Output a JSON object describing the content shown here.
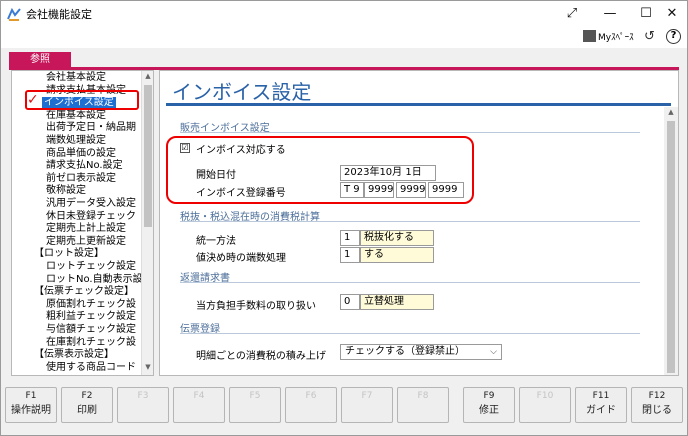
{
  "window": {
    "title": "会社機能設定",
    "minimize_glyph": "—",
    "maximize_glyph": "☐",
    "close_glyph": "✕",
    "expand_glyph": "⤢",
    "icons": [
      "app-icon",
      "expand-icon",
      "minimize-icon",
      "maximize-icon",
      "close-icon"
    ]
  },
  "toolbar": {
    "myspace_label": "Myｽﾍﾟｰｽ",
    "history_glyph": "↺",
    "help_glyph": "?"
  },
  "tab": {
    "label": "参照",
    "color": "#c7175a"
  },
  "sidebar": {
    "items": [
      {
        "label": "会社基本設定",
        "selected": false
      },
      {
        "label": "請求支払基本設定",
        "selected": false
      },
      {
        "label": "インボイス設定",
        "selected": true
      },
      {
        "label": "在庫基本設定",
        "selected": false
      },
      {
        "label": "出荷予定日・納品期",
        "selected": false
      },
      {
        "label": "端数処理設定",
        "selected": false
      },
      {
        "label": "商品単価の設定",
        "selected": false
      },
      {
        "label": "請求支払No.設定",
        "selected": false
      },
      {
        "label": "前ゼロ表示設定",
        "selected": false
      },
      {
        "label": "敬称設定",
        "selected": false
      },
      {
        "label": "汎用データ受入設定",
        "selected": false
      },
      {
        "label": "休日未登録チェック",
        "selected": false
      },
      {
        "label": "定期売上計上設定",
        "selected": false
      },
      {
        "label": "定期売上更新設定",
        "selected": false
      },
      {
        "label": "【ロット設定】",
        "selected": false
      },
      {
        "label": "ロットチェック設定",
        "selected": false
      },
      {
        "label": "ロットNo.自動表示設",
        "selected": false
      },
      {
        "label": "【伝票チェック設定】",
        "selected": false
      },
      {
        "label": "原価割れチェック設",
        "selected": false
      },
      {
        "label": "粗利益チェック設定",
        "selected": false
      },
      {
        "label": "与信額チェック設定",
        "selected": false
      },
      {
        "label": "在庫割れチェック設",
        "selected": false
      },
      {
        "label": "【伝票表示設定】",
        "selected": false
      },
      {
        "label": "使用する商品コード",
        "selected": false
      }
    ],
    "check_glyph": "✓",
    "scroll_up": "▲",
    "scroll_down": "▼"
  },
  "main": {
    "title": "インボイス設定",
    "scroll_up": "▲",
    "sections": {
      "sales_invoice": "販売インボイス設定",
      "mixed_tax": "税抜・税込混在時の消費税計算",
      "return_invoice": "返還請求書",
      "voucher": "伝票登録"
    },
    "invoice_enable": {
      "label": "インボイス対応する",
      "checked": true,
      "check_glyph": "☑"
    },
    "start_date": {
      "label": "開始日付",
      "value": "2023年10月 1日"
    },
    "reg_number": {
      "label": "インボイス登録番号",
      "prefix": "T",
      "parts": [
        "9",
        "9999",
        "9999",
        "9999"
      ]
    },
    "unify_method": {
      "label": "統一方法",
      "code": "1",
      "value": "税抜化する"
    },
    "rounding": {
      "label": "値決め時の端数処理",
      "code": "1",
      "value": "する"
    },
    "fee_handling": {
      "label": "当方負担手数料の取り扱い",
      "code": "0",
      "value": "立替処理"
    },
    "tax_accumulation": {
      "label": "明細ごとの消費税の積み上げ",
      "value": "チェックする（登録禁止）"
    }
  },
  "fkeys": [
    {
      "key": "F1",
      "label": "操作説明",
      "enabled": true
    },
    {
      "key": "F2",
      "label": "印刷",
      "enabled": true
    },
    {
      "key": "F3",
      "label": "",
      "enabled": false
    },
    {
      "key": "F4",
      "label": "",
      "enabled": false
    },
    {
      "key": "F5",
      "label": "",
      "enabled": false
    },
    {
      "key": "F6",
      "label": "",
      "enabled": false
    },
    {
      "key": "F7",
      "label": "",
      "enabled": false
    },
    {
      "key": "F8",
      "label": "",
      "enabled": false
    },
    {
      "key": "F9",
      "label": "修正",
      "enabled": true
    },
    {
      "key": "F10",
      "label": "",
      "enabled": false
    },
    {
      "key": "F11",
      "label": "ガイド",
      "enabled": true
    },
    {
      "key": "F12",
      "label": "閉じる",
      "enabled": true
    }
  ],
  "colors": {
    "accent_blue": "#2a62a8",
    "selection_blue": "#1f6fd1",
    "highlight_red": "#e00000",
    "input_yellow": "#fffbd9"
  }
}
